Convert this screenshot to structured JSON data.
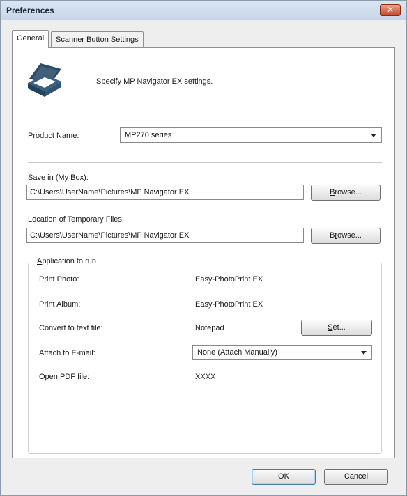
{
  "window": {
    "title": "Preferences",
    "close_glyph": "✕"
  },
  "tabs": [
    {
      "label": "General",
      "active": true
    },
    {
      "label": "Scanner Button Settings",
      "active": false
    }
  ],
  "general": {
    "icon": "scanner-icon",
    "description": "Specify MP Navigator EX settings.",
    "product_name": {
      "label_pre": "Product ",
      "label_accel": "N",
      "label_post": "ame:",
      "value": "MP270 series"
    },
    "save_in": {
      "label": "Save in (My Box):",
      "value": "C:\\Users\\UserName\\Pictures\\MP Navigator EX",
      "browse_accel": "B",
      "browse_rest": "rowse..."
    },
    "temp_files": {
      "label": "Location of Temporary Files:",
      "value": "C:\\Users\\UserName\\Pictures\\MP Navigator EX",
      "browse_pre": "B",
      "browse_accel": "r",
      "browse_rest": "owse..."
    },
    "app_group": {
      "title_accel": "A",
      "title_rest": "pplication to run",
      "rows": {
        "print_photo": {
          "label": "Print Photo:",
          "value": "Easy-PhotoPrint EX"
        },
        "print_album": {
          "label": "Print Album:",
          "value": "Easy-PhotoPrint EX"
        },
        "convert_text": {
          "label": "Convert to text file:",
          "value": "Notepad",
          "set_accel": "S",
          "set_rest": "et..."
        },
        "attach_email": {
          "label": "Attach to E-mail:",
          "value": "None (Attach Manually)"
        },
        "open_pdf": {
          "label": "Open PDF file:",
          "value": "XXXX"
        }
      }
    }
  },
  "footer": {
    "ok_label": "OK",
    "cancel_label": "Cancel"
  },
  "colors": {
    "titlebar": "#c7d6e8",
    "dialog_bg": "#eeeeee",
    "panel_bg": "#ffffff",
    "close_button": "#c9472b",
    "default_button_border": "#3c7fb1"
  }
}
